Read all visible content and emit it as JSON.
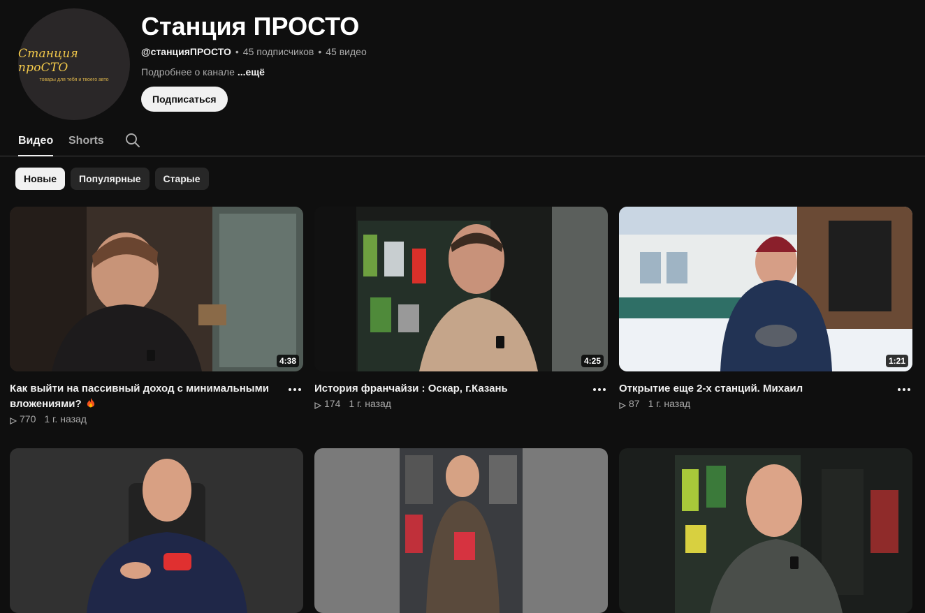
{
  "channel": {
    "avatar_title": "Станция проСТО",
    "avatar_subtitle": "товары для тебя и твоего авто",
    "name": "Станция ПРОСТО",
    "handle": "@станцияПРОСТО",
    "subscribers": "45 подписчиков",
    "videos_count": "45 видео",
    "description": "Подробнее о канале",
    "more_label": "...ещё",
    "subscribe_label": "Подписаться"
  },
  "tabs": [
    {
      "label": "Видео",
      "active": true
    },
    {
      "label": "Shorts",
      "active": false
    }
  ],
  "chips": [
    {
      "label": "Новые",
      "active": true
    },
    {
      "label": "Популярные",
      "active": false
    },
    {
      "label": "Старые",
      "active": false
    }
  ],
  "videos": [
    {
      "title": "Как выйти на пассивный доход с минимальными вложениями? ",
      "has_fire_emoji": true,
      "duration": "4:38",
      "views": "770",
      "age": "1 г. назад"
    },
    {
      "title": "История франчайзи : Оскар, г.Казань",
      "has_fire_emoji": false,
      "duration": "4:25",
      "views": "174",
      "age": "1 г. назад"
    },
    {
      "title": "Открытие еще 2-х станций. Михаил",
      "has_fire_emoji": false,
      "duration": "1:21",
      "views": "87",
      "age": "1 г. назад"
    }
  ],
  "colors": {
    "background": "#0f0f0f",
    "text_primary": "#f1f1f1",
    "text_secondary": "#aaaaaa",
    "chip_bg": "#272727",
    "avatar_accent": "#f3c94a"
  },
  "icons": {
    "search": "search-icon",
    "more": "more-vert-icon",
    "views": "play-icon",
    "emoji": "fire-icon"
  }
}
